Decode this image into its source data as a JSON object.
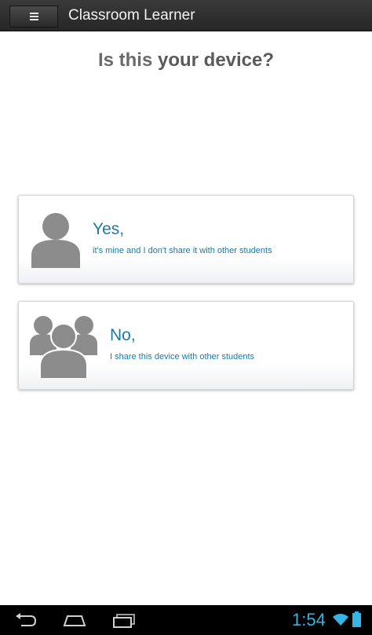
{
  "app_bar": {
    "menu_icon": "hamburger-menu-icon",
    "title": "Classroom Learner"
  },
  "question": {
    "prefix": "Is this ",
    "emphasis": "your device?"
  },
  "options": [
    {
      "icon": "single-user-icon",
      "heading": "Yes,",
      "subtext": "it's mine and I don't share it with other students"
    },
    {
      "icon": "multiple-users-icon",
      "heading": "No,",
      "subtext": "I share this device with other students"
    }
  ],
  "status_bar": {
    "time": "1:54",
    "nav_icons": [
      "back-icon",
      "home-icon",
      "recent-apps-icon"
    ],
    "status_icons": [
      "wifi-icon",
      "battery-icon"
    ]
  },
  "colors": {
    "accent": "#1a7aa7",
    "clock": "#33b5e5",
    "icon_gray": "#8c8c8c",
    "app_bar": "#2e2e2e"
  }
}
